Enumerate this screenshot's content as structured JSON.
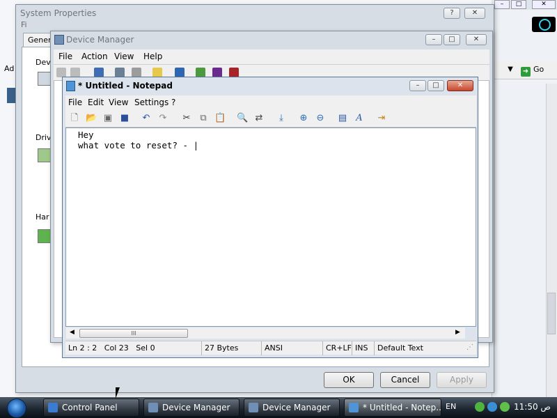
{
  "background": {
    "go_label": "Go",
    "addr_prefix": "Ad",
    "file_menu": "Fi"
  },
  "system_properties": {
    "title": "System Properties",
    "tab_label": "Genera",
    "sections": [
      "Dev",
      "Driv",
      "Har"
    ],
    "buttons": {
      "ok": "OK",
      "cancel": "Cancel",
      "apply": "Apply"
    }
  },
  "device_manager": {
    "title": "Device Manager",
    "menu": [
      "File",
      "Action",
      "View",
      "Help"
    ]
  },
  "notepad": {
    "title": "* Untitled - Notepad",
    "menu": [
      "File",
      "Edit",
      "View",
      "Settings",
      "?"
    ],
    "content": "Hey\nwhat vote to reset? - |",
    "scroll_thumb": "III",
    "status": {
      "position": "Ln 2 : 2",
      "col": "Col 23",
      "sel": "Sel 0",
      "size": "27 Bytes",
      "encoding": "ANSI",
      "line_ending": "CR+LF",
      "mode": "INS",
      "scheme": "Default Text"
    }
  },
  "taskbar": {
    "items": [
      "Control Panel",
      "Device Manager",
      "Device Manager",
      "* Untitled - Notep..."
    ],
    "language": "EN",
    "clock": "11:50 ص"
  },
  "colors": {
    "accent": "#c7472d",
    "taskbar": "#1b242e"
  }
}
